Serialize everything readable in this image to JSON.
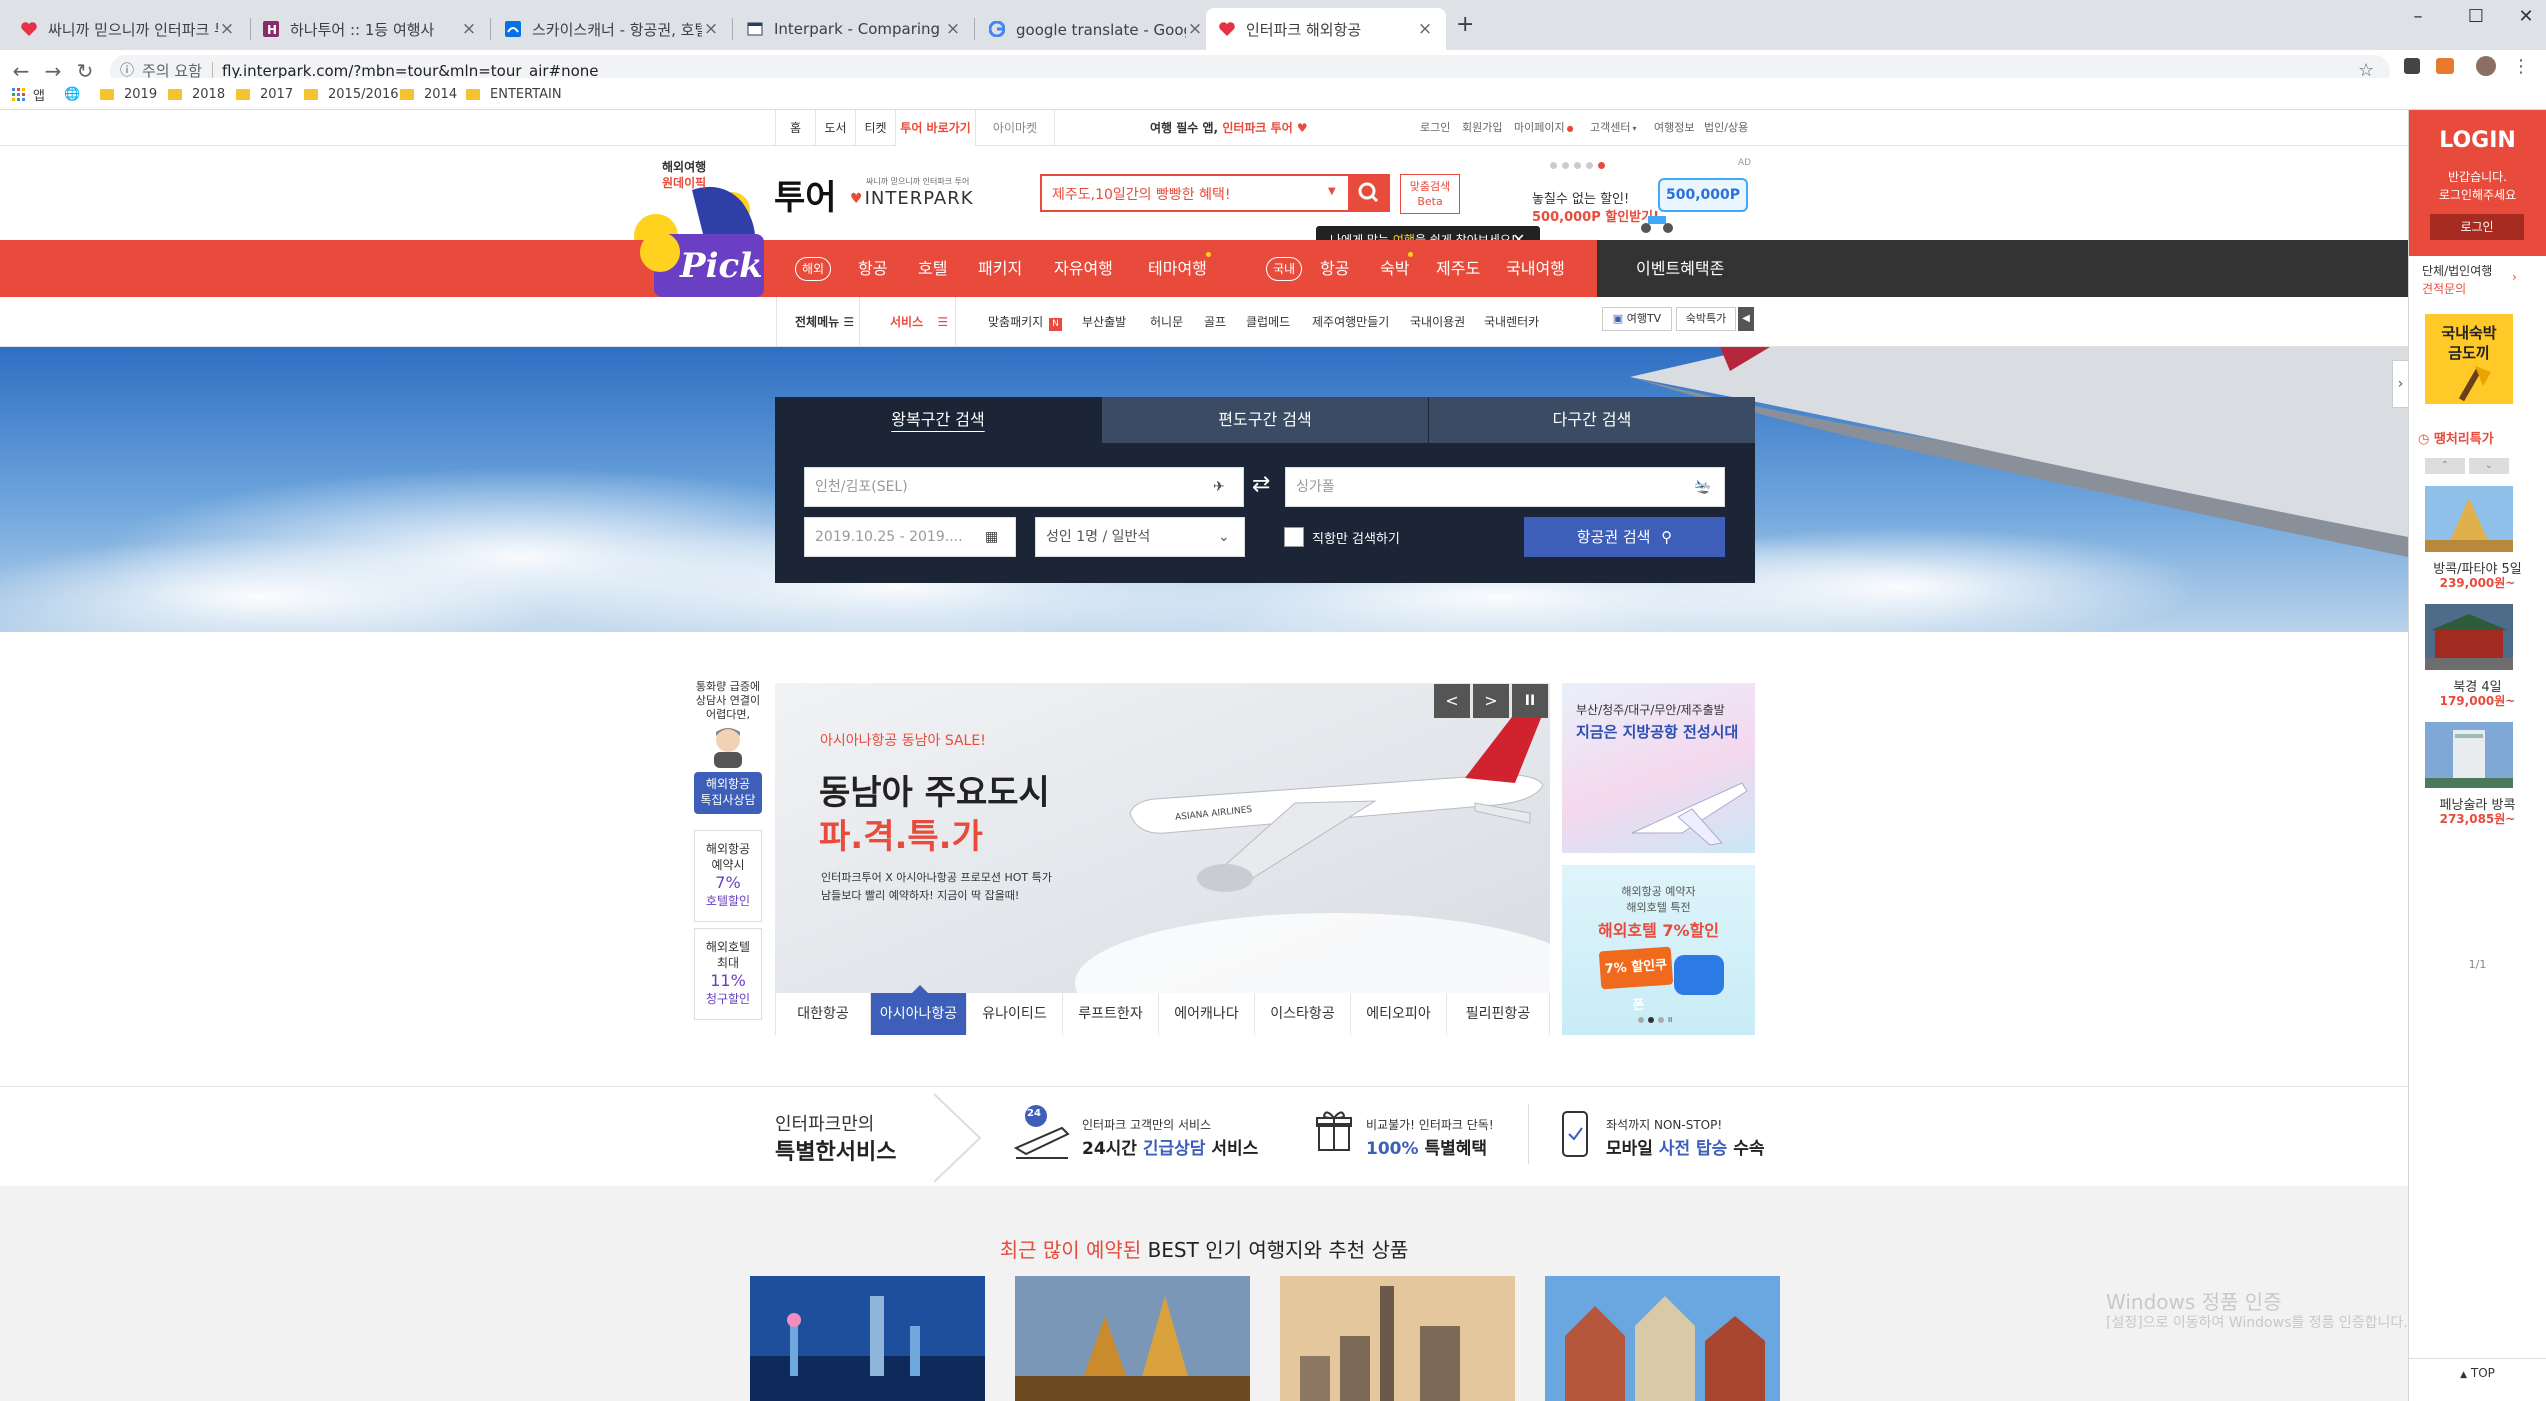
{
  "browser": {
    "tabs": [
      {
        "title": "싸니까 믿으니까 인터파크 투어",
        "favicon": "heart-icon"
      },
      {
        "title": "하나투어 :: 1등 여행사",
        "favicon": "hanatour-icon"
      },
      {
        "title": "스카이스캐너 - 항공권, 호텔, 렌트",
        "favicon": "skyscanner-icon"
      },
      {
        "title": "Interpark - Comparing the figu",
        "favicon": "doc-icon"
      },
      {
        "title": "google translate - Google 검색",
        "favicon": "google-icon"
      },
      {
        "title": "인터파크 해외항공",
        "favicon": "heart-icon"
      }
    ],
    "new_tab": "+",
    "security_label": "주의 요함",
    "url": "fly.interpark.com/?mbn=tour&mln=tour_air#none",
    "apps_label": "앱",
    "bookmarks": [
      "2019",
      "2018",
      "2017",
      "2015/2016",
      "2014",
      "ENTERTAIN"
    ]
  },
  "util": {
    "tabs": [
      "홈",
      "도서",
      "티켓",
      "투어 바로가기",
      "아이마켓"
    ],
    "promo_prefix": "여행 필수 앱,",
    "promo_brand": "인터파크 투어",
    "links": [
      "로그인",
      "회원가입",
      "마이페이지",
      "고객센터",
      "여행정보",
      "법인/상용"
    ]
  },
  "header": {
    "pick_line1": "해외여행",
    "pick_line2": "원데이픽",
    "pick_word": "Pick",
    "logo_main": "투어",
    "logo_tagline": "싸니까 믿으니까 인터파크 투어",
    "logo_brand": "INTERPARK",
    "search_placeholder": "제주도,10일간의 빵빵한 혜택!",
    "custom_search_1": "맞춤검색",
    "custom_search_2": "Beta",
    "tooltip_prefix": "나에게 맞는 ",
    "tooltip_highlight": "여행",
    "tooltip_suffix": "을 쉽게 찾아보세요!",
    "ad_line1": "놓칠수 없는 할인!",
    "ad_line2": "500,000P 할인받기!",
    "ad_amount": "500,000P",
    "ad_label": "AD"
  },
  "nav": {
    "overseas_pill": "해외",
    "overseas_items": [
      "항공",
      "호텔",
      "패키지",
      "자유여행",
      "테마여행"
    ],
    "domestic_pill": "국내",
    "domestic_items": [
      "항공",
      "숙박",
      "제주도",
      "국내여행"
    ],
    "event": "이벤트혜택존"
  },
  "subnav": {
    "all_menu": "전체메뉴",
    "service": "서비스",
    "items": [
      "맞춤패키지",
      "부산출발",
      "허니문",
      "골프",
      "클럽메드",
      "제주여행만들기",
      "국내이용권",
      "국내렌터카"
    ],
    "new_badge": "N",
    "tv_label": "여행TV",
    "special_label": "숙박특가"
  },
  "flight_search": {
    "tabs": [
      "왕복구간 검색",
      "편도구간 검색",
      "다구간 검색"
    ],
    "origin": "인천/김포(SEL)",
    "destination": "싱가폴",
    "dates": "2019.10.25 - 2019....",
    "passengers": "성인 1명 / 일반석",
    "direct_only": "직항만 검색하기",
    "search_button": "항공권 검색"
  },
  "left_promos": {
    "counsel_intro": "통화량 급증에 상담사 연결이 어렵다면,",
    "counsel_btn_1": "해외항공",
    "counsel_btn_2": "톡집사상담",
    "box1_line1": "해외항공",
    "box1_line2": "예약시",
    "box1_pct": "7%",
    "box1_line3": "호텔할인",
    "box2_line1": "해외호텔",
    "box2_line2": "최대",
    "box2_pct": "11%",
    "box2_line3": "청구할인"
  },
  "carousel": {
    "tag": "아시아나항공 동남아 SALE!",
    "title_1": "동남아 주요도시",
    "title_2": "파.격.특.가",
    "desc_1": "인터파크투어 X 아시아나항공 프로모션 HOT 특가",
    "desc_2": "남들보다 빨리 예약하자! 지금이 딱 잡을때!",
    "plane_livery": "ASIANA AIRLINES",
    "prev": "<",
    "next": ">",
    "pause": "II",
    "tabs": [
      "대한항공",
      "아시아나항공",
      "유나이티드",
      "루프트한자",
      "에어캐나다",
      "이스타항공",
      "에티오피아",
      "필리핀항공"
    ],
    "active_tab": 1
  },
  "right_banners": {
    "b1_line1": "부산/청주/대구/무안/제주출발",
    "b1_line2": "지금은 지방공항 전성시대",
    "b2_line1": "해외항공 예약자",
    "b2_line2": "해외호텔 특전",
    "b2_title": "해외호텔 7%할인",
    "b2_coupon": "7% 할인쿠폰"
  },
  "services": {
    "heading_1": "인터파크만의",
    "heading_2": "특별한서비스",
    "s1_small": "인터파크 고객만의 서비스",
    "s1_badge": "24",
    "s1_pre": "24시간 ",
    "s1_hl": "긴급상담",
    "s1_post": " 서비스",
    "s2_small": "비교불가! 인터파크 단독!",
    "s2_hl": "100%",
    "s2_post": " 특별혜택",
    "s3_small": "좌석까지 NON-STOP!",
    "s3_pre": "모바일 ",
    "s3_hl": "사전 탑승",
    "s3_post": " 수속"
  },
  "best": {
    "heading_red": "최근 많이 예약된",
    "heading_rest": " BEST 인기 여행지와 추천 상품"
  },
  "right_sidebar": {
    "login_title": "LOGIN",
    "login_msg_1": "반갑습니다.",
    "login_msg_2": "로그인해주세요",
    "login_button": "로그인",
    "group_1": "단체/법인여행",
    "group_2": "견적문의",
    "banner_1": "국내숙박",
    "banner_2": "금도끼",
    "special_title": "땡처리특가",
    "deals": [
      {
        "name": "방콕/파타야 5일",
        "price": "239,000원~"
      },
      {
        "name": "북경 4일",
        "price": "179,000원~"
      },
      {
        "name": "페낭술라 방콕",
        "price": "273,085원~"
      }
    ],
    "pager": "1/1",
    "top": "TOP"
  },
  "watermark": {
    "line1": "Windows 정품 인증",
    "line2": "[설정]으로 이동하여 Windows를 정품 인증합니다."
  },
  "colors": {
    "brand_red": "#e84b3c",
    "search_dark": "#1b2536",
    "search_button": "#3d5fb9",
    "purple": "#6a3fc3"
  }
}
